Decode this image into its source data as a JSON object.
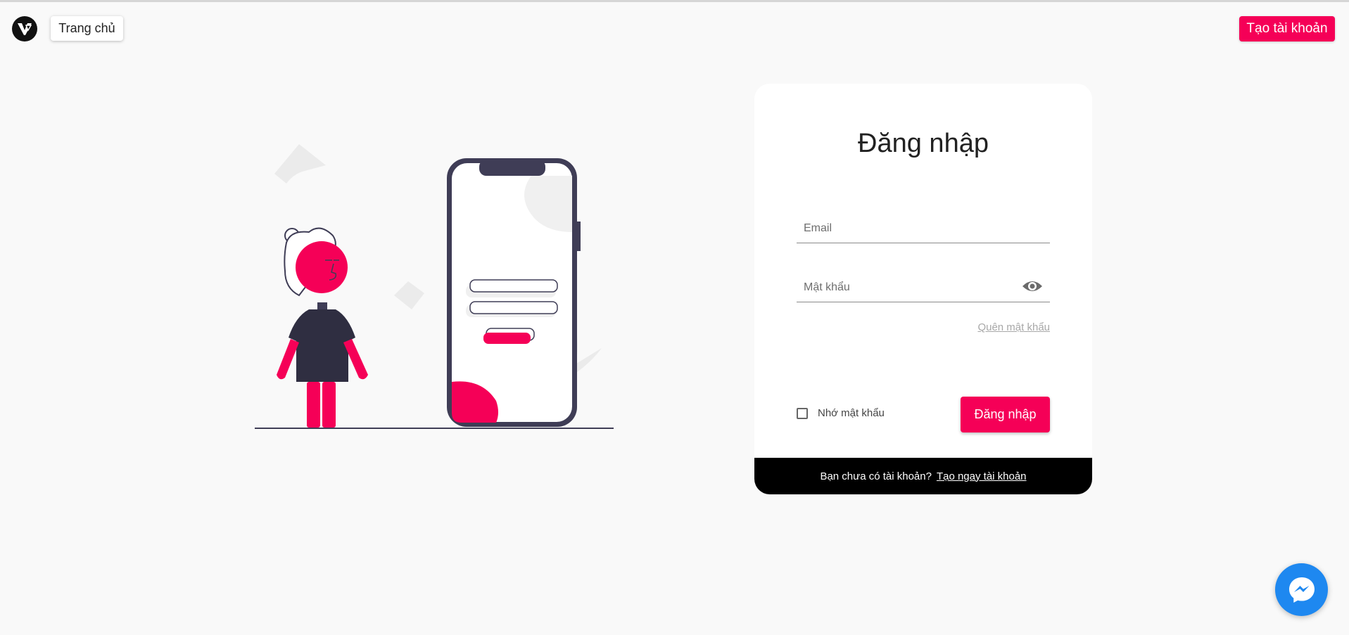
{
  "header": {
    "home_label": "Trang chủ",
    "signup_label": "Tạo tài khoản",
    "logo_icon": "brand-logo-icon"
  },
  "login": {
    "title": "Đăng nhập",
    "email_placeholder": "Email",
    "email_value": "",
    "password_placeholder": "Mật khẩu",
    "password_value": "",
    "show_password_icon": "eye-icon",
    "forgot_label": "Quên mật khẩu",
    "remember_label": "Nhớ mật khẩu",
    "remember_checked": false,
    "submit_label": "Đăng nhập",
    "footer_text": "Bạn chưa có tài khoản?",
    "footer_link": "Tạo ngay tài khoản"
  },
  "chat_widget": {
    "icon": "messenger-icon"
  },
  "colors": {
    "accent": "#f50057",
    "background": "#f9f9f9",
    "footer_bg": "#000000",
    "messenger": "#1e88f0",
    "illustration_dark": "#3f3d56"
  }
}
